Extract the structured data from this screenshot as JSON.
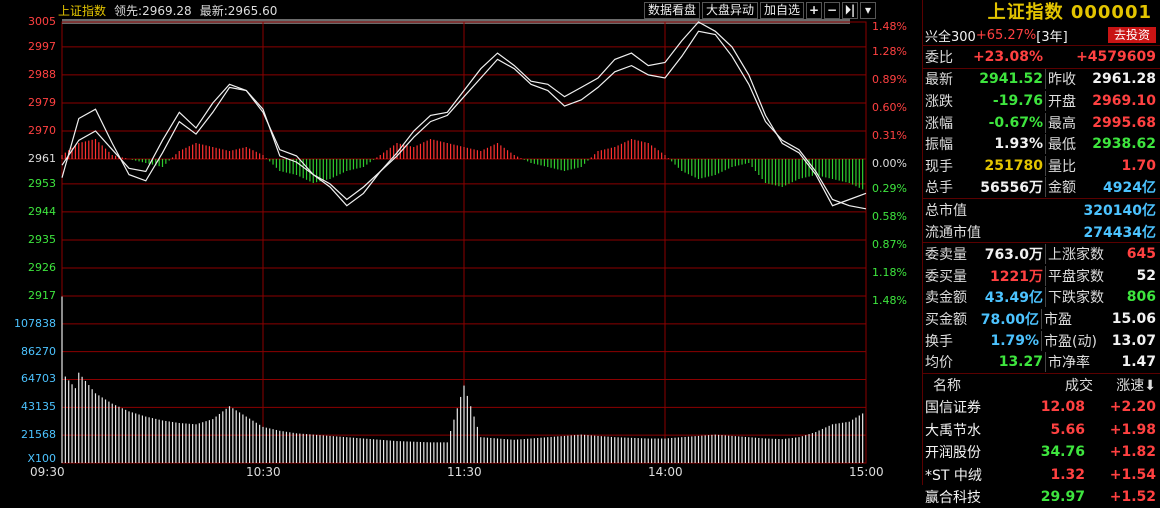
{
  "chart": {
    "index_name": "上证指数",
    "leading_label": "领先:",
    "leading_value": "2969.28",
    "latest_label": "最新:",
    "latest_value": "2965.60",
    "tools": [
      "数据看盘",
      "大盘异动",
      "加自选"
    ],
    "tool_icons": [
      "plus-icon",
      "minus-icon",
      "skip-right-icon",
      "dropdown-icon"
    ]
  },
  "chart_data": {
    "type": "line",
    "prev_close": 2961,
    "price_axis": {
      "ticks": [
        3005,
        2997,
        2988,
        2979,
        2970,
        2961,
        2953,
        2944,
        2935,
        2926,
        2917
      ],
      "percent_ticks": [
        "1.48%",
        "1.28%",
        "0.89%",
        "0.60%",
        "0.31%",
        "0.00%",
        "0.29%",
        "0.58%",
        "0.87%",
        "1.18%",
        "1.48%"
      ],
      "ylim": [
        2917,
        3005
      ]
    },
    "volume_axis": {
      "ticks": [
        "107838",
        "86270",
        "64703",
        "43135",
        "21568",
        "X100"
      ],
      "ylim": [
        0,
        129405
      ]
    },
    "time_labels": [
      "09:30",
      "10:30",
      "11:30",
      "14:00",
      "15:00"
    ],
    "series": [
      {
        "x": [
          0,
          5,
          10,
          15,
          20,
          25,
          30,
          35,
          40,
          45,
          50,
          55,
          60,
          65,
          70,
          75,
          80,
          85,
          90,
          95,
          100,
          105,
          110,
          115,
          120,
          125,
          130,
          135,
          140,
          145,
          150,
          155,
          160,
          165,
          170,
          175,
          180,
          185,
          190,
          195,
          200,
          205,
          210,
          215,
          220,
          225,
          230,
          235,
          240
        ],
        "values": [
          2959,
          2967,
          2970,
          2964,
          2958,
          2957,
          2967,
          2976,
          2971,
          2979,
          2985,
          2983,
          2977,
          2962,
          2960,
          2956,
          2952,
          2946,
          2950,
          2957,
          2963,
          2970,
          2975,
          2976,
          2983,
          2990,
          2995,
          2991,
          2986,
          2985,
          2981,
          2984,
          2987,
          2993,
          2995,
          2991,
          2992,
          2999,
          3005,
          3002,
          2997,
          2988,
          2975,
          2966,
          2963,
          2956,
          2946,
          2948,
          2950
        ]
      },
      {
        "x": [
          0,
          5,
          10,
          15,
          20,
          25,
          30,
          35,
          40,
          45,
          50,
          55,
          60,
          65,
          70,
          75,
          80,
          85,
          90,
          95,
          100,
          105,
          110,
          115,
          120,
          125,
          130,
          135,
          140,
          145,
          150,
          155,
          160,
          165,
          170,
          175,
          180,
          185,
          190,
          195,
          200,
          205,
          210,
          215,
          220,
          225,
          230,
          235,
          240
        ],
        "values": [
          2955,
          2974,
          2977,
          2966,
          2956,
          2954,
          2963,
          2973,
          2969,
          2976,
          2984,
          2983,
          2976,
          2964,
          2962,
          2956,
          2953,
          2948,
          2952,
          2957,
          2962,
          2968,
          2973,
          2975,
          2981,
          2987,
          2993,
          2990,
          2985,
          2983,
          2978,
          2980,
          2984,
          2989,
          2991,
          2988,
          2987,
          2994,
          3002,
          3001,
          2994,
          2985,
          2973,
          2967,
          2964,
          2957,
          2948,
          2946,
          2945
        ]
      }
    ],
    "diff_bars": {
      "x": [
        0,
        5,
        10,
        15,
        20,
        25,
        30,
        35,
        40,
        45,
        50,
        55,
        60,
        65,
        70,
        75,
        80,
        85,
        90,
        95,
        100,
        105,
        110,
        115,
        120,
        125,
        130,
        135,
        140,
        145,
        150,
        155,
        160,
        165,
        170,
        175,
        180,
        185,
        190,
        195,
        200,
        205,
        210,
        215,
        220,
        225,
        230,
        235,
        240
      ],
      "values": [
        1,
        4,
        5,
        1,
        0,
        -1,
        -2,
        2,
        4,
        3,
        2,
        3,
        1,
        -3,
        -4,
        -6,
        -5,
        -3,
        -2,
        1,
        4,
        3,
        5,
        4,
        3,
        2,
        4,
        1,
        -1,
        -2,
        -3,
        -2,
        2,
        3,
        5,
        4,
        1,
        -3,
        -5,
        -4,
        -2,
        -1,
        -6,
        -7,
        -5,
        -4,
        -5,
        -6,
        -8
      ]
    },
    "volume": {
      "x": [
        0,
        5,
        10,
        15,
        20,
        25,
        30,
        35,
        40,
        45,
        50,
        55,
        60,
        65,
        70,
        75,
        80,
        85,
        90,
        95,
        100,
        105,
        110,
        115,
        120,
        125,
        130,
        135,
        140,
        145,
        150,
        155,
        160,
        165,
        170,
        175,
        180,
        185,
        190,
        195,
        200,
        205,
        210,
        215,
        220,
        225,
        230,
        235,
        240
      ],
      "values": [
        129000,
        70000,
        54000,
        46000,
        40000,
        36000,
        33000,
        31000,
        30000,
        34000,
        44000,
        36000,
        28000,
        25000,
        23000,
        22000,
        21000,
        20000,
        19000,
        18000,
        17000,
        16500,
        16000,
        16000,
        60000,
        20000,
        19000,
        18000,
        19000,
        20000,
        21000,
        22000,
        21000,
        20000,
        19500,
        19000,
        19000,
        20000,
        21000,
        22000,
        21000,
        20000,
        19000,
        18500,
        20000,
        24000,
        30000,
        32000,
        40000
      ]
    }
  },
  "panel": {
    "title": "上证指数 000001",
    "product": {
      "name": "兴全300",
      "change": "+65.27%",
      "period": "[3年]",
      "invest_label": "去投资"
    },
    "weibi": {
      "label": "委比",
      "ratio": "+23.08%",
      "diff": "+4579609"
    },
    "quote_rows": [
      {
        "l1": "最新",
        "v1": "2941.52",
        "c1": "green",
        "l2": "昨收",
        "v2": "2961.28",
        "c2": "white"
      },
      {
        "l1": "涨跌",
        "v1": "-19.76",
        "c1": "green",
        "l2": "开盘",
        "v2": "2969.10",
        "c2": "red"
      },
      {
        "l1": "涨幅",
        "v1": "-0.67%",
        "c1": "green",
        "l2": "最高",
        "v2": "2995.68",
        "c2": "red"
      },
      {
        "l1": "振幅",
        "v1": "1.93%",
        "c1": "white",
        "l2": "最低",
        "v2": "2938.62",
        "c2": "green"
      },
      {
        "l1": "现手",
        "v1": "251780",
        "c1": "yellow",
        "l2": "量比",
        "v2": "1.70",
        "c2": "red"
      },
      {
        "l1": "总手",
        "v1": "56556万",
        "c1": "white",
        "l2": "金额",
        "v2": "4924亿",
        "c2": "cyan"
      }
    ],
    "cap_rows": [
      {
        "l": "总市值",
        "v": "320140亿"
      },
      {
        "l": "流通市值",
        "v": "274434亿"
      }
    ],
    "order_rows": [
      {
        "l1": "委卖量",
        "v1": "763.0万",
        "c1": "white",
        "l2": "上涨家数",
        "v2": "645",
        "c2": "red"
      },
      {
        "l1": "委买量",
        "v1": "1221万",
        "c1": "red",
        "l2": "平盘家数",
        "v2": "52",
        "c2": "white"
      },
      {
        "l1": "卖金额",
        "v1": "43.49亿",
        "c1": "cyan",
        "l2": "下跌家数",
        "v2": "806",
        "c2": "green"
      },
      {
        "l1": "买金额",
        "v1": "78.00亿",
        "c1": "cyan",
        "l2": "市盈",
        "v2": "15.06",
        "c2": "white"
      },
      {
        "l1": "换手",
        "v1": "1.79%",
        "c1": "cyan",
        "l2": "市盈(动)",
        "v2": "13.07",
        "c2": "white"
      },
      {
        "l1": "均价",
        "v1": "13.27",
        "c1": "green",
        "l2": "市净率",
        "v2": "1.47",
        "c2": "white"
      }
    ],
    "list_header": {
      "name": "名称",
      "volume": "成交",
      "speed": "涨速"
    },
    "stocks": [
      {
        "name": "国信证券",
        "price": "12.08",
        "pc": "red",
        "speed": "+2.20"
      },
      {
        "name": "大禹节水",
        "price": "5.66",
        "pc": "red",
        "speed": "+1.98"
      },
      {
        "name": "开润股份",
        "price": "34.76",
        "pc": "green",
        "speed": "+1.82"
      },
      {
        "name": "*ST 中绒",
        "price": "1.32",
        "pc": "red",
        "speed": "+1.54"
      },
      {
        "name": "赢合科技",
        "price": "29.97",
        "pc": "green",
        "speed": "+1.52"
      }
    ]
  }
}
